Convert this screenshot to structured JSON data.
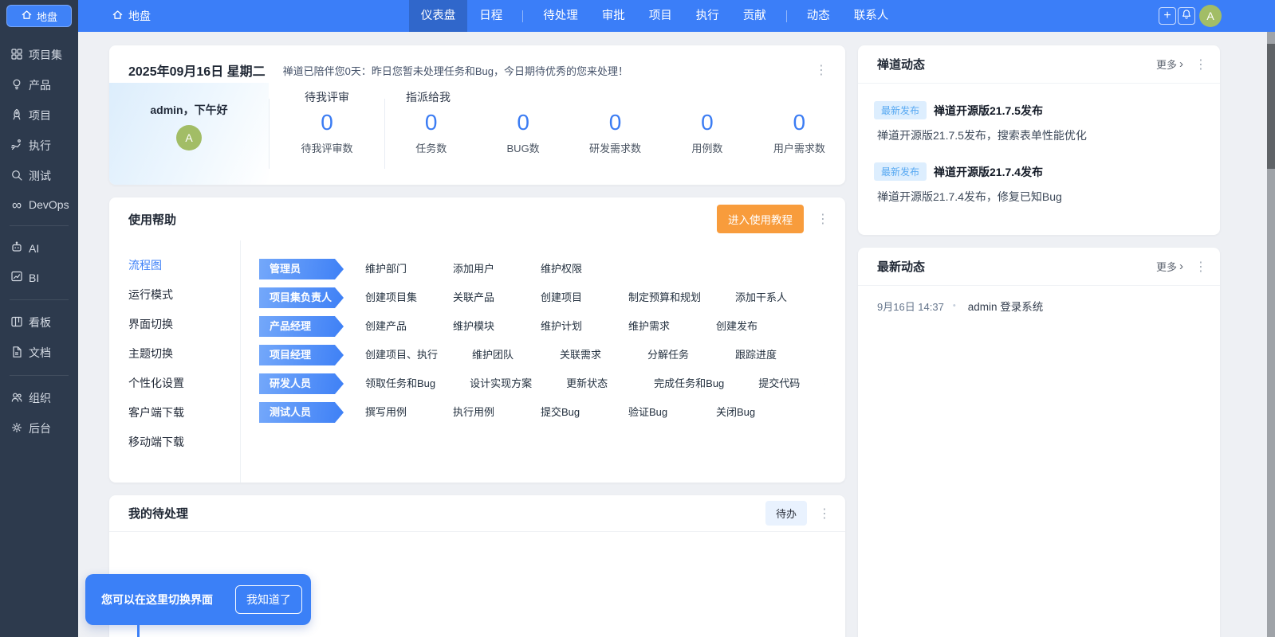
{
  "colors": {
    "accent": "#3b7ef8",
    "sidebar_bg": "#2d3a4d",
    "orange_button": "#f89c3c",
    "avatar_green": "#a2bd66",
    "stat_number_blue": "#3b7cf3",
    "badge_bg": "#ddeefe",
    "badge_text": "#58a9f2"
  },
  "icons": {
    "plus": "+",
    "kebab": "⋮",
    "more_chevron": "›",
    "infinity": "∞",
    "bullet": "•"
  },
  "topbar": {
    "brand": "地盘",
    "nav": [
      {
        "label": "仪表盘",
        "active": true
      },
      {
        "label": "日程"
      },
      {
        "label": "待处理"
      },
      {
        "label": "审批"
      },
      {
        "label": "项目"
      },
      {
        "label": "执行"
      },
      {
        "label": "贡献"
      },
      {
        "label": "动态"
      },
      {
        "label": "联系人"
      }
    ],
    "avatar": "A"
  },
  "sidebar": {
    "home_label": "地盘",
    "items": [
      {
        "icon": "grid-icon",
        "label": "项目集"
      },
      {
        "icon": "bulb-icon",
        "label": "产品"
      },
      {
        "icon": "rocket-icon",
        "label": "项目"
      },
      {
        "icon": "run-icon",
        "label": "执行"
      },
      {
        "icon": "search-icon",
        "label": "测试"
      },
      {
        "icon": "infinity-icon",
        "label": "DevOps"
      },
      {
        "icon": "robot-icon",
        "label": "AI"
      },
      {
        "icon": "chart-icon",
        "label": "BI"
      },
      {
        "icon": "kanban-icon",
        "label": "看板"
      },
      {
        "icon": "document-icon",
        "label": "文档"
      },
      {
        "icon": "people-icon",
        "label": "组织"
      },
      {
        "icon": "gear-icon",
        "label": "后台"
      }
    ]
  },
  "welcome": {
    "date": "2025年09月16日 星期二",
    "message": "禅道已陪伴您0天：昨日您暂未处理任务和Bug，今日期待优秀的您来处理！",
    "greeting": "admin，下午好",
    "avatar": "A",
    "review_group": {
      "header": "待我评审",
      "stats": [
        {
          "value": "0",
          "label": "待我评审数"
        }
      ]
    },
    "assigned_group": {
      "header": "指派给我",
      "stats": [
        {
          "value": "0",
          "label": "任务数"
        },
        {
          "value": "0",
          "label": "BUG数"
        },
        {
          "value": "0",
          "label": "研发需求数"
        },
        {
          "value": "0",
          "label": "用例数"
        },
        {
          "value": "0",
          "label": "用户需求数"
        }
      ]
    }
  },
  "help": {
    "title": "使用帮助",
    "button_label": "进入使用教程",
    "tabs": [
      {
        "label": "流程图",
        "active": true
      },
      {
        "label": "运行模式"
      },
      {
        "label": "界面切换"
      },
      {
        "label": "主题切换"
      },
      {
        "label": "个性化设置"
      },
      {
        "label": "客户端下载"
      },
      {
        "label": "移动端下载"
      }
    ],
    "flows": [
      {
        "role": "管理员",
        "steps": [
          "维护部门",
          "添加用户",
          "维护权限"
        ]
      },
      {
        "role": "项目集负责人",
        "steps": [
          "创建项目集",
          "关联产品",
          "创建项目",
          "制定预算和规划",
          "添加干系人"
        ]
      },
      {
        "role": "产品经理",
        "steps": [
          "创建产品",
          "维护模块",
          "维护计划",
          "维护需求",
          "创建发布"
        ]
      },
      {
        "role": "项目经理",
        "steps": [
          "创建项目、执行",
          "维护团队",
          "关联需求",
          "分解任务",
          "跟踪进度"
        ]
      },
      {
        "role": "研发人员",
        "steps": [
          "领取任务和Bug",
          "设计实现方案",
          "更新状态",
          "完成任务和Bug",
          "提交代码"
        ]
      },
      {
        "role": "测试人员",
        "steps": [
          "撰写用例",
          "执行用例",
          "提交Bug",
          "验证Bug",
          "关闭Bug"
        ]
      }
    ]
  },
  "todo": {
    "title": "我的待处理",
    "filter_label": "待办"
  },
  "news": {
    "title": "禅道动态",
    "more_label": "更多",
    "items": [
      {
        "badge": "最新发布",
        "title": "禅道开源版21.7.5发布",
        "desc": "禅道开源版21.7.5发布，搜索表单性能优化"
      },
      {
        "badge": "最新发布",
        "title": "禅道开源版21.7.4发布",
        "desc": "禅道开源版21.7.4发布，修复已知Bug"
      }
    ]
  },
  "latest": {
    "title": "最新动态",
    "more_label": "更多",
    "items": [
      {
        "time": "9月16日 14:37",
        "text": "admin 登录系统"
      }
    ]
  },
  "tooltip": {
    "text": "您可以在这里切换界面",
    "button_label": "我知道了"
  }
}
